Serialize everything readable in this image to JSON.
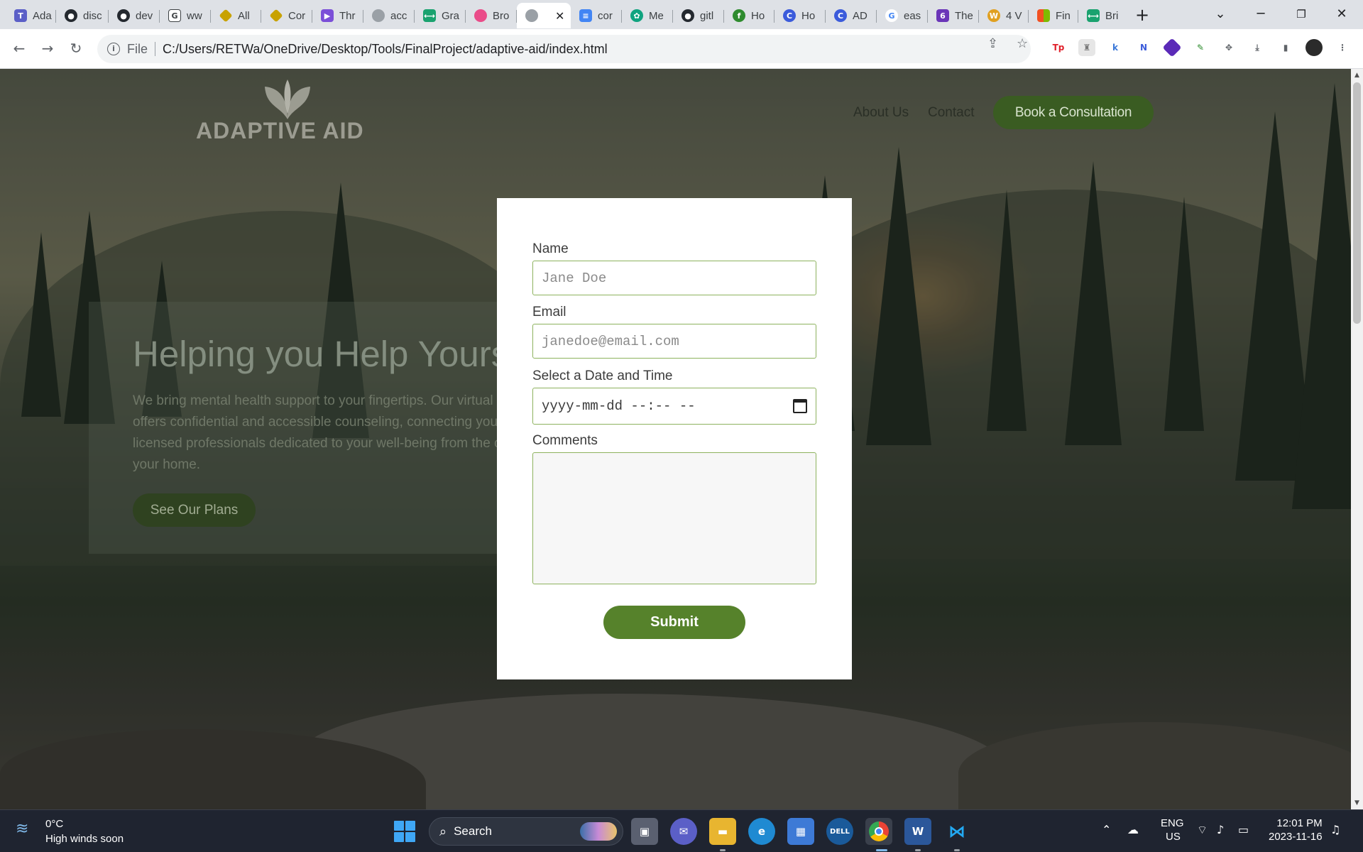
{
  "browser": {
    "tabs": [
      {
        "label": "Ada",
        "favicon": "teams-icon",
        "color": "#5b5fc7"
      },
      {
        "label": "disc",
        "favicon": "github-icon",
        "color": "#24292f"
      },
      {
        "label": "dev",
        "favicon": "github-icon",
        "color": "#24292f"
      },
      {
        "label": "ww",
        "favicon": "doc-icon",
        "color": "#3c4043"
      },
      {
        "label": "All",
        "favicon": "diamond-icon",
        "color": "#c8a200"
      },
      {
        "label": "Cor",
        "favicon": "diamond-icon",
        "color": "#c8a200"
      },
      {
        "label": "Thr",
        "favicon": "arrow-icon",
        "color": "#7b4fd8"
      },
      {
        "label": "acc",
        "favicon": "globe-icon",
        "color": "#9aa0a6"
      },
      {
        "label": "Gra",
        "favicon": "bridge-icon",
        "color": "#1aa26f"
      },
      {
        "label": "Bro",
        "favicon": "dribbble-icon",
        "color": "#ea4c89"
      },
      {
        "label": "",
        "favicon": "globe-icon",
        "color": "#9aa0a6"
      },
      {
        "label": "cor",
        "favicon": "docs-icon",
        "color": "#4285f4"
      },
      {
        "label": "Me",
        "favicon": "chatgpt-icon",
        "color": "#10a37f"
      },
      {
        "label": "gitl",
        "favicon": "github-icon",
        "color": "#24292f"
      },
      {
        "label": "Ho",
        "favicon": "leaf-icon",
        "color": "#2e8b2e"
      },
      {
        "label": "Ho",
        "favicon": "c-icon",
        "color": "#3b5bdb"
      },
      {
        "label": "AD",
        "favicon": "c-icon",
        "color": "#3b5bdb"
      },
      {
        "label": "eas",
        "favicon": "google-icon",
        "color": "#4285f4"
      },
      {
        "label": "The",
        "favicon": "six-icon",
        "color": "#6a35b8"
      },
      {
        "label": "4 V",
        "favicon": "w-icon",
        "color": "#e0a020"
      },
      {
        "label": "Fin",
        "favicon": "microsoft-icon",
        "color": "#f25022"
      },
      {
        "label": "Bri",
        "favicon": "bridge-icon",
        "color": "#1aa26f"
      }
    ],
    "active_tab_close": "✕",
    "new_tab": "+",
    "address": {
      "scheme": "File",
      "url": "C:/Users/RETWa/OneDrive/Desktop/Tools/FinalProject/adaptive-aid/index.html"
    }
  },
  "site": {
    "logo_text": "ADAPTIVE AID",
    "nav": {
      "about": "About Us",
      "contact": "Contact",
      "cta": "Book a Consultation"
    },
    "hero": {
      "title": "Helping you Help Yourself",
      "body": "We bring mental health support to your fingertips. Our virtual platform offers confidential and accessible counseling, connecting you with licensed professionals dedicated to your well-being from the comfort of your home.",
      "button": "See Our Plans"
    }
  },
  "form": {
    "name_label": "Name",
    "name_placeholder": "Jane Doe",
    "email_label": "Email",
    "email_placeholder": "janedoe@email.com",
    "datetime_label": "Select a Date and Time",
    "datetime_value": "yyyy-mm-dd --:-- --",
    "comments_label": "Comments",
    "comments_value": "",
    "submit": "Submit"
  },
  "taskbar": {
    "weather_temp": "0°C",
    "weather_desc": "High winds soon",
    "search": "Search",
    "lang_1": "ENG",
    "lang_2": "US",
    "time": "12:01 PM",
    "date": "2023-11-16"
  },
  "colors": {
    "brand_green": "#56822b",
    "field_border": "#8db25e",
    "cta_green": "#3a5c22"
  }
}
